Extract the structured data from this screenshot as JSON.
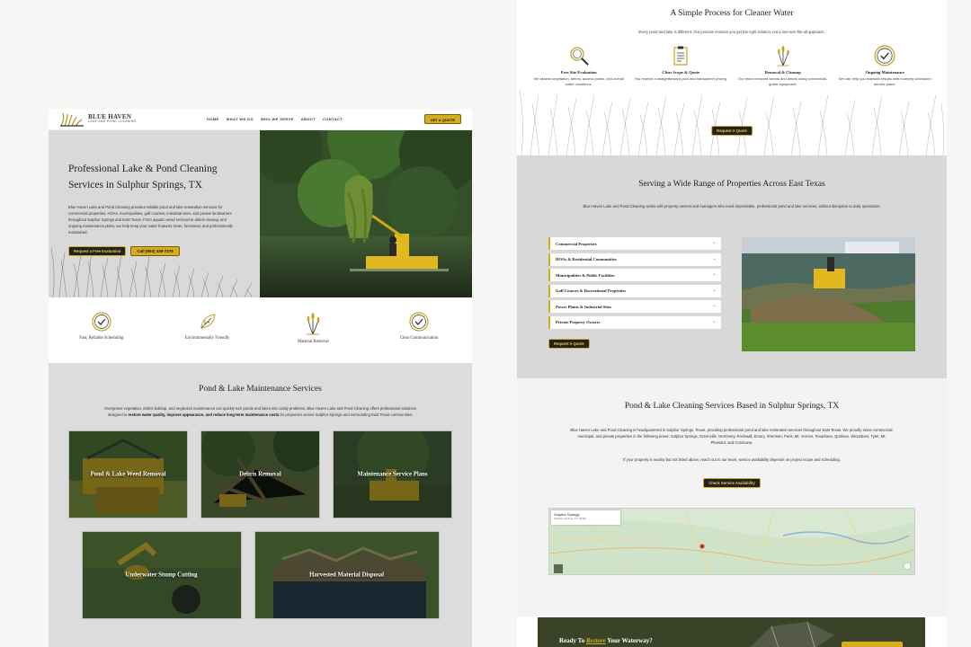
{
  "site": {
    "logo_name": "BLUE HAVEN",
    "logo_tagline": "LAKE AND POND CLEANING",
    "nav": [
      "HOME",
      "WHAT WE DO",
      "WHO WE SERVE",
      "ABOUT",
      "CONTACT"
    ],
    "nav_cta": "GET A QUOTE"
  },
  "hero": {
    "title": "Professional Lake & Pond Cleaning Services in Sulphur Springs, TX",
    "body": "Blue Haven Lake and Pond Cleaning provides reliable pond and lake restoration services for commercial properties, HOAs, municipalities, golf courses, industrial sites, and private landowners throughout Sulphur Springs and East Texas. From aquatic weed removal to debris cleanup and ongoing maintenance plans, we help keep your water features clean, functional, and professionally maintained.",
    "btn_primary": "Request a Free Evaluation",
    "btn_call": "Call (903) 439-7379"
  },
  "features": [
    {
      "label": "Fast, Reliable Scheduling",
      "icon": "check-badge-icon"
    },
    {
      "label": "Environmentally Friendly",
      "icon": "leaf-icon"
    },
    {
      "label": "Material Removal",
      "icon": "reeds-icon"
    },
    {
      "label": "Clear Communication",
      "icon": "check-badge-icon"
    }
  ],
  "services": {
    "title": "Pond & Lake Maintenance Services",
    "body_a": "Overgrown vegetation, debris buildup, and neglected maintenance can quickly turn ponds and lakes into costly problems. Blue Haven Lake and Pond Cleaning offers professional solutions designed to ",
    "body_bold": "restore water quality, improve appearance, and reduce long-term maintenance costs",
    "body_b": " for properties across Sulphur Springs and surrounding East Texas communities.",
    "cards": [
      "Pond & Lake Weed Removal",
      "Debris Removal",
      "Maintenance Service Plans",
      "Underwater Stump Cutting",
      "Harvested Material Disposal"
    ]
  },
  "process": {
    "title": "A Simple Process for Cleaner Water",
    "subtitle": "Every pond and lake is different. Our process ensures you get the right solution, not a one-size-fits-all approach.",
    "steps": [
      {
        "title": "Free Site Evaluation",
        "desc": "We assess vegetation, debris, access points, and overall water conditions.",
        "icon": "magnifier-icon"
      },
      {
        "title": "Clear Scope & Quote",
        "desc": "You receive a straightforward plan and transparent pricing.",
        "icon": "clipboard-icon"
      },
      {
        "title": "Removal & Cleanup",
        "desc": "Our team removes weeds and debris using commercial-grade equipment.",
        "icon": "reeds-icon"
      },
      {
        "title": "Ongoing Maintenance",
        "desc": "We can help you maintain results with routinely scheduled service plans.",
        "icon": "check-badge-icon"
      }
    ],
    "cta": "Request A Quote"
  },
  "properties": {
    "title": "Serving a Wide Range of Properties Across East Texas",
    "subtitle": "Blue Haven Lake and Pond Cleaning works with property owners and managers who need dependable, professional pond and lake services, without disruption to daily operations.",
    "items": [
      "Commercial Properties",
      "HOAs & Residential Communities",
      "Municipalities & Public Facilities",
      "Golf Courses & Recreational Properties",
      "Power Plants & Industrial Sites",
      "Private Property Owners"
    ],
    "toggle": "+",
    "cta": "Request A Quote"
  },
  "based": {
    "title": "Pond & Lake Cleaning Services Based in Sulphur Springs, TX",
    "p1": "Blue Haven Lake and Pond Cleaning is headquartered in Sulphur Springs, Texas, providing professional pond and lake restoration services throughout East Texas. We proudly serve commercial, municipal, and private properties in the following areas: Sulphur Springs, Greenville, McKinney, Rockwall, Emory, Sherman, Paris, Mt. Vernon, Texarkana, Quitman, Winnsboro, Tyler, Mt. Pleasant, and Corsicana.",
    "p2": "If your property is nearby but not listed above, reach out to our team; service availability depends on project scope and scheduling.",
    "cta": "Check Service Availability",
    "map_name": "Sulphur Springs",
    "map_addr": "Sulphur Springs, TX 75482"
  },
  "banner": {
    "pre": "Ready To ",
    "em": "Restore",
    "post": " Your Waterway?"
  },
  "colors": {
    "accent": "#d6ad1f",
    "dark": "#222222",
    "panel": "#d9d9d9"
  }
}
